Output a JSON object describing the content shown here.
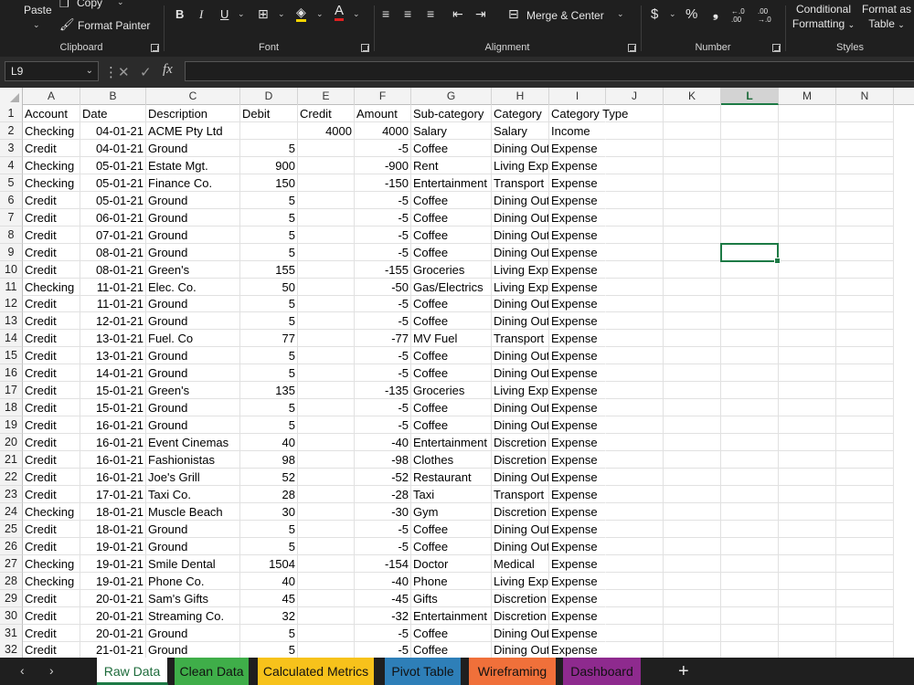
{
  "ribbon": {
    "clipboard": {
      "label": "Clipboard",
      "paste": "Paste",
      "copy": "Copy",
      "format_painter": "Format Painter"
    },
    "font": {
      "label": "Font",
      "bold": "B",
      "italic": "I",
      "underline": "U"
    },
    "alignment": {
      "label": "Alignment",
      "merge_center": "Merge & Center"
    },
    "number": {
      "label": "Number",
      "currency": "$",
      "percent": "%",
      "comma": "❟",
      "inc_decimal": "←.0 .00",
      "dec_decimal": ".00 →.0"
    },
    "styles": {
      "label": "Styles",
      "conditional_line1": "Conditional",
      "conditional_line2": "Formatting",
      "format_table_line1": "Format as",
      "format_table_line2": "Table"
    }
  },
  "formula_bar": {
    "name_box": "L9",
    "fx": "fx",
    "cancel": "✕",
    "enter": "✓",
    "value": ""
  },
  "columns": [
    "A",
    "B",
    "C",
    "D",
    "E",
    "F",
    "G",
    "H",
    "I",
    "J",
    "K",
    "L",
    "M",
    "N"
  ],
  "selected_column": "L",
  "selected_cell": "L9",
  "rows": [
    {
      "n": "1",
      "a": "Account",
      "b": "Date",
      "c": "Description",
      "d": "Debit",
      "e": "Credit",
      "f": "Amount",
      "g": "Sub-category",
      "h": "Category",
      "i": "Category Type"
    },
    {
      "n": "2",
      "a": "Checking",
      "b": "04-01-21",
      "c": "ACME Pty Ltd",
      "d": "",
      "e": "4000",
      "f": "4000",
      "g": "Salary",
      "h": "Salary",
      "i": "Income"
    },
    {
      "n": "3",
      "a": "Credit",
      "b": "04-01-21",
      "c": "Ground",
      "d": "5",
      "e": "",
      "f": "-5",
      "g": "Coffee",
      "h": "Dining Out",
      "i": "Expense"
    },
    {
      "n": "4",
      "a": "Checking",
      "b": "05-01-21",
      "c": "Estate Mgt.",
      "d": "900",
      "e": "",
      "f": "-900",
      "g": "Rent",
      "h": "Living Expe",
      "i": "Expense"
    },
    {
      "n": "5",
      "a": "Checking",
      "b": "05-01-21",
      "c": "Finance Co.",
      "d": "150",
      "e": "",
      "f": "-150",
      "g": "Entertainment",
      "h": "Transport",
      "i": "Expense"
    },
    {
      "n": "6",
      "a": "Credit",
      "b": "05-01-21",
      "c": "Ground",
      "d": "5",
      "e": "",
      "f": "-5",
      "g": "Coffee",
      "h": "Dining Out",
      "i": "Expense"
    },
    {
      "n": "7",
      "a": "Credit",
      "b": "06-01-21",
      "c": "Ground",
      "d": "5",
      "e": "",
      "f": "-5",
      "g": "Coffee",
      "h": "Dining Out",
      "i": "Expense"
    },
    {
      "n": "8",
      "a": "Credit",
      "b": "07-01-21",
      "c": "Ground",
      "d": "5",
      "e": "",
      "f": "-5",
      "g": "Coffee",
      "h": "Dining Out",
      "i": "Expense"
    },
    {
      "n": "9",
      "a": "Credit",
      "b": "08-01-21",
      "c": "Ground",
      "d": "5",
      "e": "",
      "f": "-5",
      "g": "Coffee",
      "h": "Dining Out",
      "i": "Expense"
    },
    {
      "n": "10",
      "a": "Credit",
      "b": "08-01-21",
      "c": "Green's",
      "d": "155",
      "e": "",
      "f": "-155",
      "g": "Groceries",
      "h": "Living Expe",
      "i": "Expense"
    },
    {
      "n": "11",
      "a": "Checking",
      "b": "11-01-21",
      "c": "Elec. Co.",
      "d": "50",
      "e": "",
      "f": "-50",
      "g": "Gas/Electrics",
      "h": "Living Expe",
      "i": "Expense"
    },
    {
      "n": "12",
      "a": "Credit",
      "b": "11-01-21",
      "c": "Ground",
      "d": "5",
      "e": "",
      "f": "-5",
      "g": "Coffee",
      "h": "Dining Out",
      "i": "Expense"
    },
    {
      "n": "13",
      "a": "Credit",
      "b": "12-01-21",
      "c": "Ground",
      "d": "5",
      "e": "",
      "f": "-5",
      "g": "Coffee",
      "h": "Dining Out",
      "i": "Expense"
    },
    {
      "n": "14",
      "a": "Credit",
      "b": "13-01-21",
      "c": "Fuel. Co",
      "d": "77",
      "e": "",
      "f": "-77",
      "g": "MV Fuel",
      "h": "Transport",
      "i": "Expense"
    },
    {
      "n": "15",
      "a": "Credit",
      "b": "13-01-21",
      "c": "Ground",
      "d": "5",
      "e": "",
      "f": "-5",
      "g": "Coffee",
      "h": "Dining Out",
      "i": "Expense"
    },
    {
      "n": "16",
      "a": "Credit",
      "b": "14-01-21",
      "c": "Ground",
      "d": "5",
      "e": "",
      "f": "-5",
      "g": "Coffee",
      "h": "Dining Out",
      "i": "Expense"
    },
    {
      "n": "17",
      "a": "Credit",
      "b": "15-01-21",
      "c": "Green's",
      "d": "135",
      "e": "",
      "f": "-135",
      "g": "Groceries",
      "h": "Living Expe",
      "i": "Expense"
    },
    {
      "n": "18",
      "a": "Credit",
      "b": "15-01-21",
      "c": "Ground",
      "d": "5",
      "e": "",
      "f": "-5",
      "g": "Coffee",
      "h": "Dining Out",
      "i": "Expense"
    },
    {
      "n": "19",
      "a": "Credit",
      "b": "16-01-21",
      "c": "Ground",
      "d": "5",
      "e": "",
      "f": "-5",
      "g": "Coffee",
      "h": "Dining Out",
      "i": "Expense"
    },
    {
      "n": "20",
      "a": "Credit",
      "b": "16-01-21",
      "c": "Event Cinemas",
      "d": "40",
      "e": "",
      "f": "-40",
      "g": "Entertainment",
      "h": "Discretion",
      "i": "Expense"
    },
    {
      "n": "21",
      "a": "Credit",
      "b": "16-01-21",
      "c": "Fashionistas",
      "d": "98",
      "e": "",
      "f": "-98",
      "g": "Clothes",
      "h": "Discretion",
      "i": "Expense"
    },
    {
      "n": "22",
      "a": "Credit",
      "b": "16-01-21",
      "c": "Joe's Grill",
      "d": "52",
      "e": "",
      "f": "-52",
      "g": "Restaurant",
      "h": "Dining Out",
      "i": "Expense"
    },
    {
      "n": "23",
      "a": "Credit",
      "b": "17-01-21",
      "c": "Taxi Co.",
      "d": "28",
      "e": "",
      "f": "-28",
      "g": "Taxi",
      "h": "Transport",
      "i": "Expense"
    },
    {
      "n": "24",
      "a": "Checking",
      "b": "18-01-21",
      "c": "Muscle Beach",
      "d": "30",
      "e": "",
      "f": "-30",
      "g": "Gym",
      "h": "Discretion",
      "i": "Expense"
    },
    {
      "n": "25",
      "a": "Credit",
      "b": "18-01-21",
      "c": "Ground",
      "d": "5",
      "e": "",
      "f": "-5",
      "g": "Coffee",
      "h": "Dining Out",
      "i": "Expense"
    },
    {
      "n": "26",
      "a": "Credit",
      "b": "19-01-21",
      "c": "Ground",
      "d": "5",
      "e": "",
      "f": "-5",
      "g": "Coffee",
      "h": "Dining Out",
      "i": "Expense"
    },
    {
      "n": "27",
      "a": "Checking",
      "b": "19-01-21",
      "c": "Smile Dental",
      "d": "1504",
      "e": "",
      "f": "-154",
      "g": "Doctor",
      "h": "Medical",
      "i": "Expense"
    },
    {
      "n": "28",
      "a": "Checking",
      "b": "19-01-21",
      "c": "Phone Co.",
      "d": "40",
      "e": "",
      "f": "-40",
      "g": "Phone",
      "h": "Living Expe",
      "i": "Expense"
    },
    {
      "n": "29",
      "a": "Credit",
      "b": "20-01-21",
      "c": "Sam's Gifts",
      "d": "45",
      "e": "",
      "f": "-45",
      "g": "Gifts",
      "h": "Discretion",
      "i": "Expense"
    },
    {
      "n": "30",
      "a": "Credit",
      "b": "20-01-21",
      "c": "Streaming Co.",
      "d": "32",
      "e": "",
      "f": "-32",
      "g": "Entertainment",
      "h": "Discretion",
      "i": "Expense"
    },
    {
      "n": "31",
      "a": "Credit",
      "b": "20-01-21",
      "c": "Ground",
      "d": "5",
      "e": "",
      "f": "-5",
      "g": "Coffee",
      "h": "Dining Out",
      "i": "Expense"
    },
    {
      "n": "32",
      "a": "Credit",
      "b": "21-01-21",
      "c": "Ground",
      "d": "5",
      "e": "",
      "f": "-5",
      "g": "Coffee",
      "h": "Dining Out",
      "i": "Expense"
    }
  ],
  "sheet_tabs": [
    {
      "label": "Raw Data",
      "color": "#ffffff",
      "active": true
    },
    {
      "label": "Clean Data",
      "color": "#3fae49",
      "active": false
    },
    {
      "label": "Calculated Metrics",
      "color": "#f7c21b",
      "active": false
    },
    {
      "label": "Pivot Table",
      "color": "#2e7fb8",
      "active": false
    },
    {
      "label": "Wireframing",
      "color": "#f0703a",
      "active": false
    },
    {
      "label": "Dashboard",
      "color": "#8e2a8e",
      "active": false
    }
  ],
  "add_sheet": "+",
  "colors": {
    "accent": "#1d7a45",
    "ribbon_bg": "#1f1f1f",
    "header_bg": "#f3f3f3"
  }
}
